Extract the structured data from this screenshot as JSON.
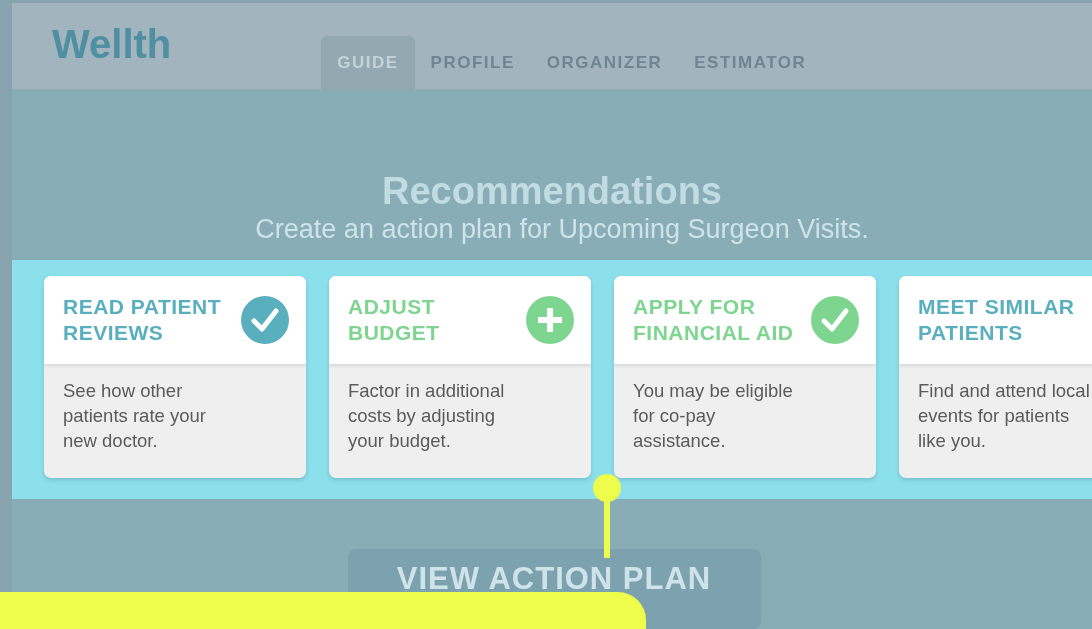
{
  "header": {
    "logo": "Wellth",
    "tabs": [
      {
        "label": "GUIDE",
        "selected": true
      },
      {
        "label": "PROFILE",
        "selected": false
      },
      {
        "label": "ORGANIZER",
        "selected": false
      },
      {
        "label": "ESTIMATOR",
        "selected": false
      }
    ]
  },
  "title": "Recommendations",
  "subtitle": "Create an action plan for Upcoming Surgeon Visits.",
  "cards": [
    {
      "title": "READ PATIENT REVIEWS",
      "text": "See how other patients rate your new doctor.",
      "kind": "check",
      "color": "#5aafbe"
    },
    {
      "title": "ADJUST BUDGET",
      "text": "Factor in additional costs by adjusting your budget.",
      "kind": "plus",
      "color": "#7dd58f"
    },
    {
      "title": "APPLY FOR FINANCIAL AID",
      "text": "You may be eligible for co-pay assistance.",
      "kind": "check",
      "color": "#7dd58f"
    },
    {
      "title": "MEET SIMILAR PATIENTS",
      "text": "Find and attend local events for patients like you.",
      "kind": "plain",
      "color": "#5aafbe"
    }
  ],
  "button": "VIEW ACTION PLAN"
}
